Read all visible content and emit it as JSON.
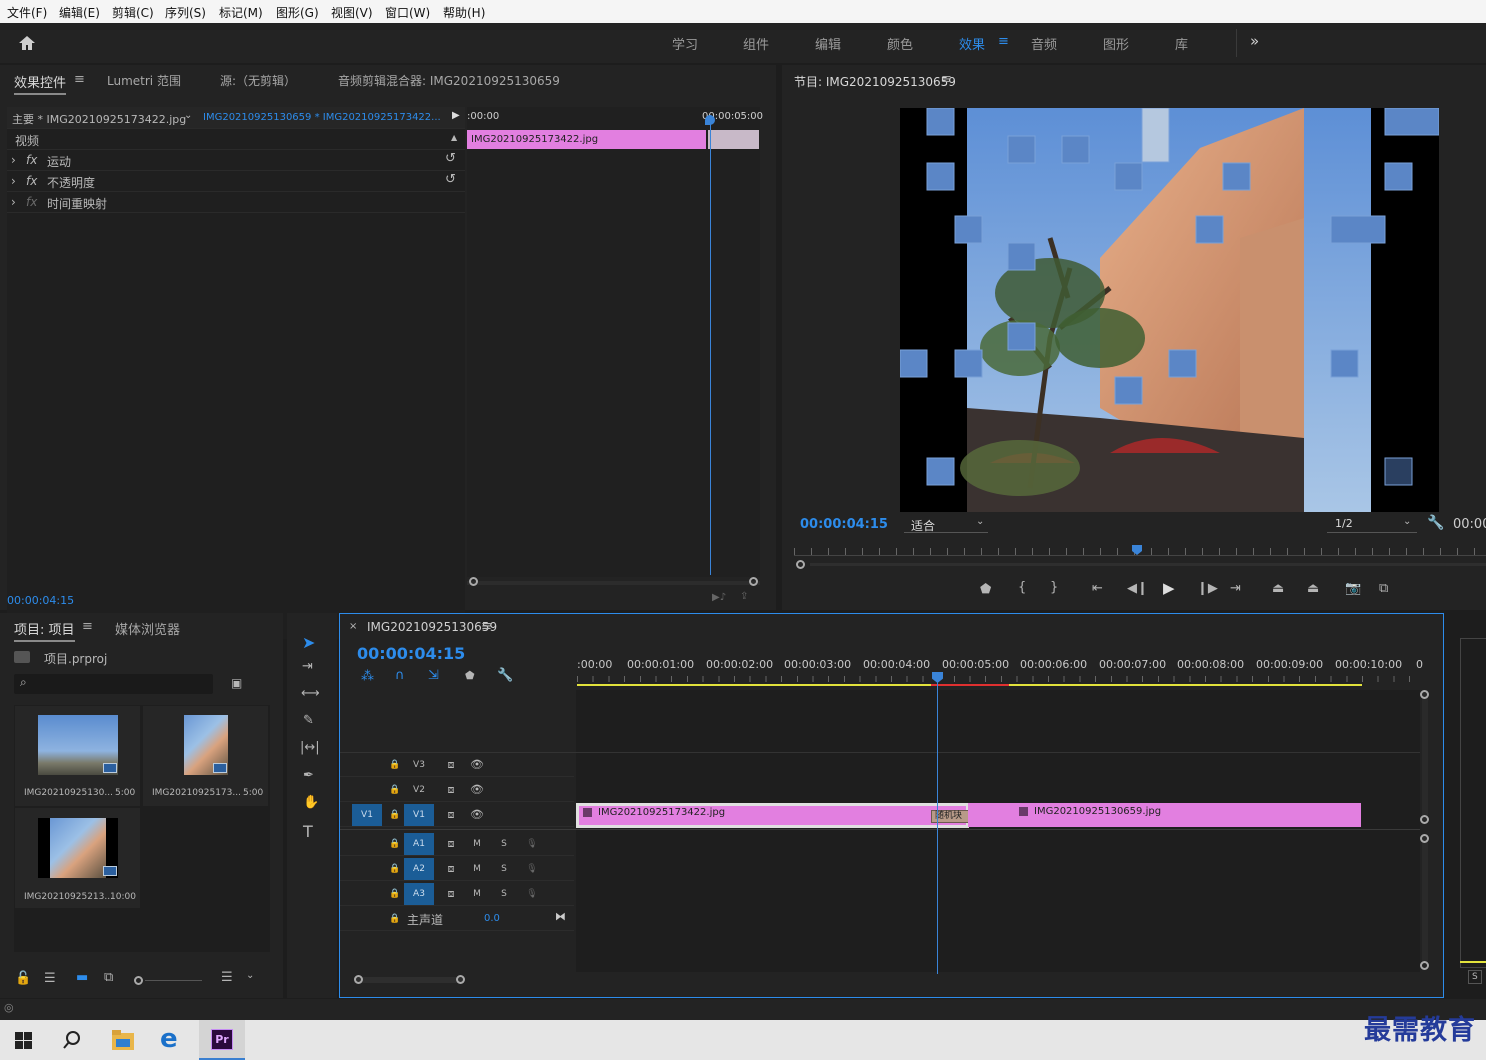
{
  "menu": [
    "文件(F)",
    "编辑(E)",
    "剪辑(C)",
    "序列(S)",
    "标记(M)",
    "图形(G)",
    "视图(V)",
    "窗口(W)",
    "帮助(H)"
  ],
  "workspaces": [
    "学习",
    "组件",
    "编辑",
    "颜色",
    "效果",
    "音频",
    "图形",
    "库"
  ],
  "active_workspace": "效果",
  "effect_controls": {
    "tabs": [
      "效果控件",
      "Lumetri 范围",
      "源:（无剪辑）",
      "音频剪辑混合器: IMG20210925130659"
    ],
    "master": "主要 * IMG20210925173422.jpg",
    "sequence_clip": "IMG20210925130659 * IMG20210925173422...",
    "section": "视频",
    "effects": [
      "运动",
      "不透明度",
      "时间重映射"
    ],
    "ruler_start": ":00:00",
    "ruler_end": "00:00:05:00",
    "clip_name": "IMG20210925173422.jpg",
    "timecode": "00:00:04:15"
  },
  "program": {
    "title": "节目: IMG20210925130659",
    "timecode": "00:00:04:15",
    "fit": "适合",
    "resolution": "1/2",
    "duration": "00:00"
  },
  "project": {
    "tabs": [
      "项目: 项目",
      "媒体浏览器"
    ],
    "file": "项目.prproj",
    "items": [
      {
        "name": "IMG20210925130...",
        "dur": "5:00"
      },
      {
        "name": "IMG20210925173...",
        "dur": "5:00"
      },
      {
        "name": "IMG20210925213...",
        "dur": "10:00"
      }
    ]
  },
  "timeline": {
    "tab": "IMG20210925130659",
    "timecode": "00:00:04:15",
    "ruler": [
      ":00:00",
      "00:00:01:00",
      "00:00:02:00",
      "00:00:03:00",
      "00:00:04:00",
      "00:00:05:00",
      "00:00:06:00",
      "00:00:07:00",
      "00:00:08:00",
      "00:00:09:00",
      "00:00:10:00",
      "0"
    ],
    "video_tracks": [
      "V3",
      "V2",
      "V1"
    ],
    "audio_tracks": [
      "A1",
      "A2",
      "A3"
    ],
    "source_patch": "V1",
    "master": "主声道",
    "master_value": "0.0",
    "clip1": "IMG20210925173422.jpg",
    "transition": "随机块",
    "clip2": "IMG20210925130659.jpg",
    "m_label": "M",
    "s_label": "S"
  },
  "watermark": "最需教育",
  "colors": {
    "accent": "#2d8ceb",
    "clip": "#e27fe0",
    "panel": "#232323"
  }
}
